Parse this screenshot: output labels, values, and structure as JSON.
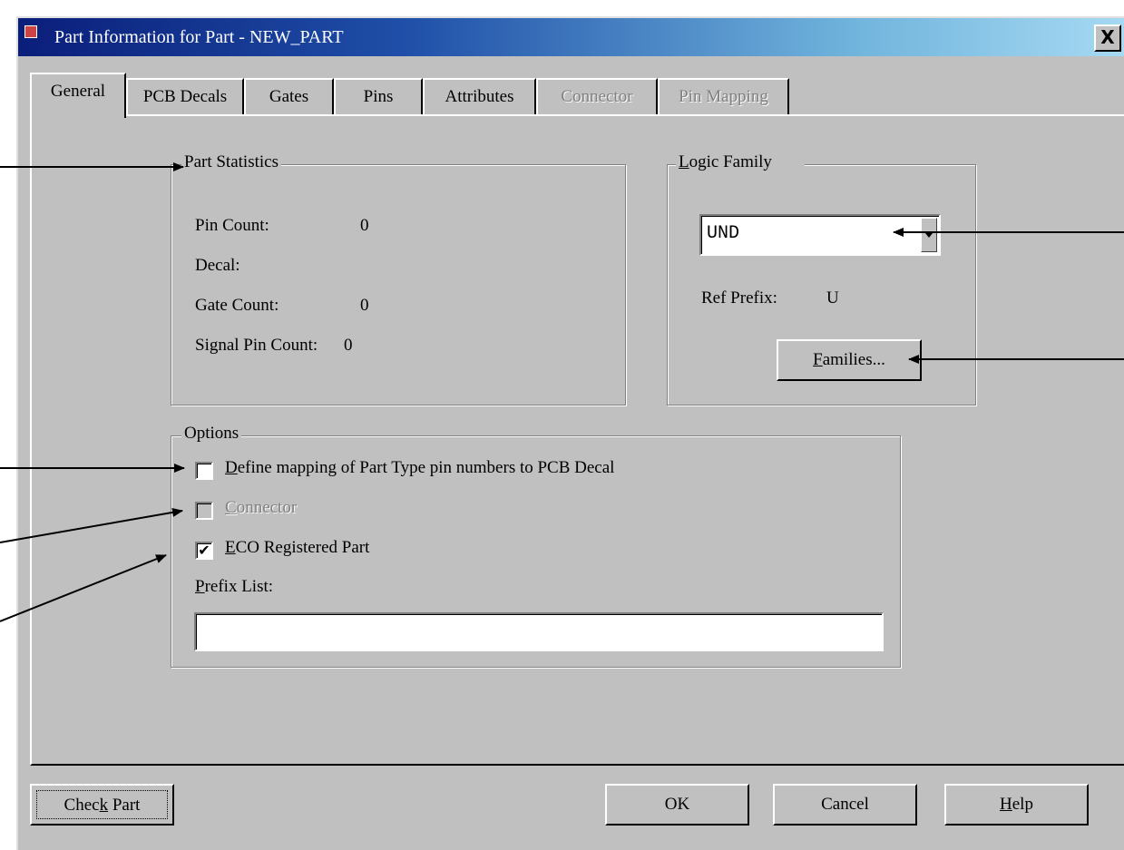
{
  "window": {
    "title": "Part Information for Part - NEW_PART",
    "close": "X"
  },
  "tabs": [
    {
      "label": "General",
      "state": "active"
    },
    {
      "label": "PCB Decals",
      "state": "normal"
    },
    {
      "label": "Gates",
      "state": "normal"
    },
    {
      "label": "Pins",
      "state": "normal"
    },
    {
      "label": "Attributes",
      "state": "normal"
    },
    {
      "label": "Connector",
      "state": "disabled"
    },
    {
      "label": "Pin Mapping",
      "state": "disabled"
    }
  ],
  "part_statistics": {
    "legend": "Part Statistics",
    "pin_count_label": "Pin Count:",
    "pin_count_value": "0",
    "decal_label": "Decal:",
    "gate_count_label": "Gate Count:",
    "gate_count_value": "0",
    "signal_pin_count_label": "Signal Pin Count:",
    "signal_pin_count_value": "0"
  },
  "logic_family": {
    "legend_hotkey": "L",
    "legend_rest": "ogic Family",
    "selected": "UND",
    "ref_prefix_label": "Ref Prefix:",
    "ref_prefix_value": "U",
    "families_hotkey": "F",
    "families_rest": "amilies..."
  },
  "options": {
    "legend": "Options",
    "define_mapping": {
      "hotkey": "D",
      "rest": "efine mapping of Part Type pin numbers to PCB Decal",
      "checked": false,
      "enabled": true
    },
    "connector": {
      "hotkey": "C",
      "rest": "onnector",
      "checked": false,
      "enabled": false
    },
    "eco_registered": {
      "hotkey": "E",
      "rest": "CO Registered Part",
      "checked": true,
      "enabled": true,
      "mark": "✔"
    },
    "prefix_list_hotkey": "P",
    "prefix_list_rest": "refix List:",
    "prefix_list_value": ""
  },
  "buttons": {
    "check_part_pre": "Chec",
    "check_part_hotkey": "k",
    "check_part_post": " Part",
    "ok": "OK",
    "cancel": "Cancel",
    "help_hotkey": "H",
    "help_rest": "elp"
  }
}
